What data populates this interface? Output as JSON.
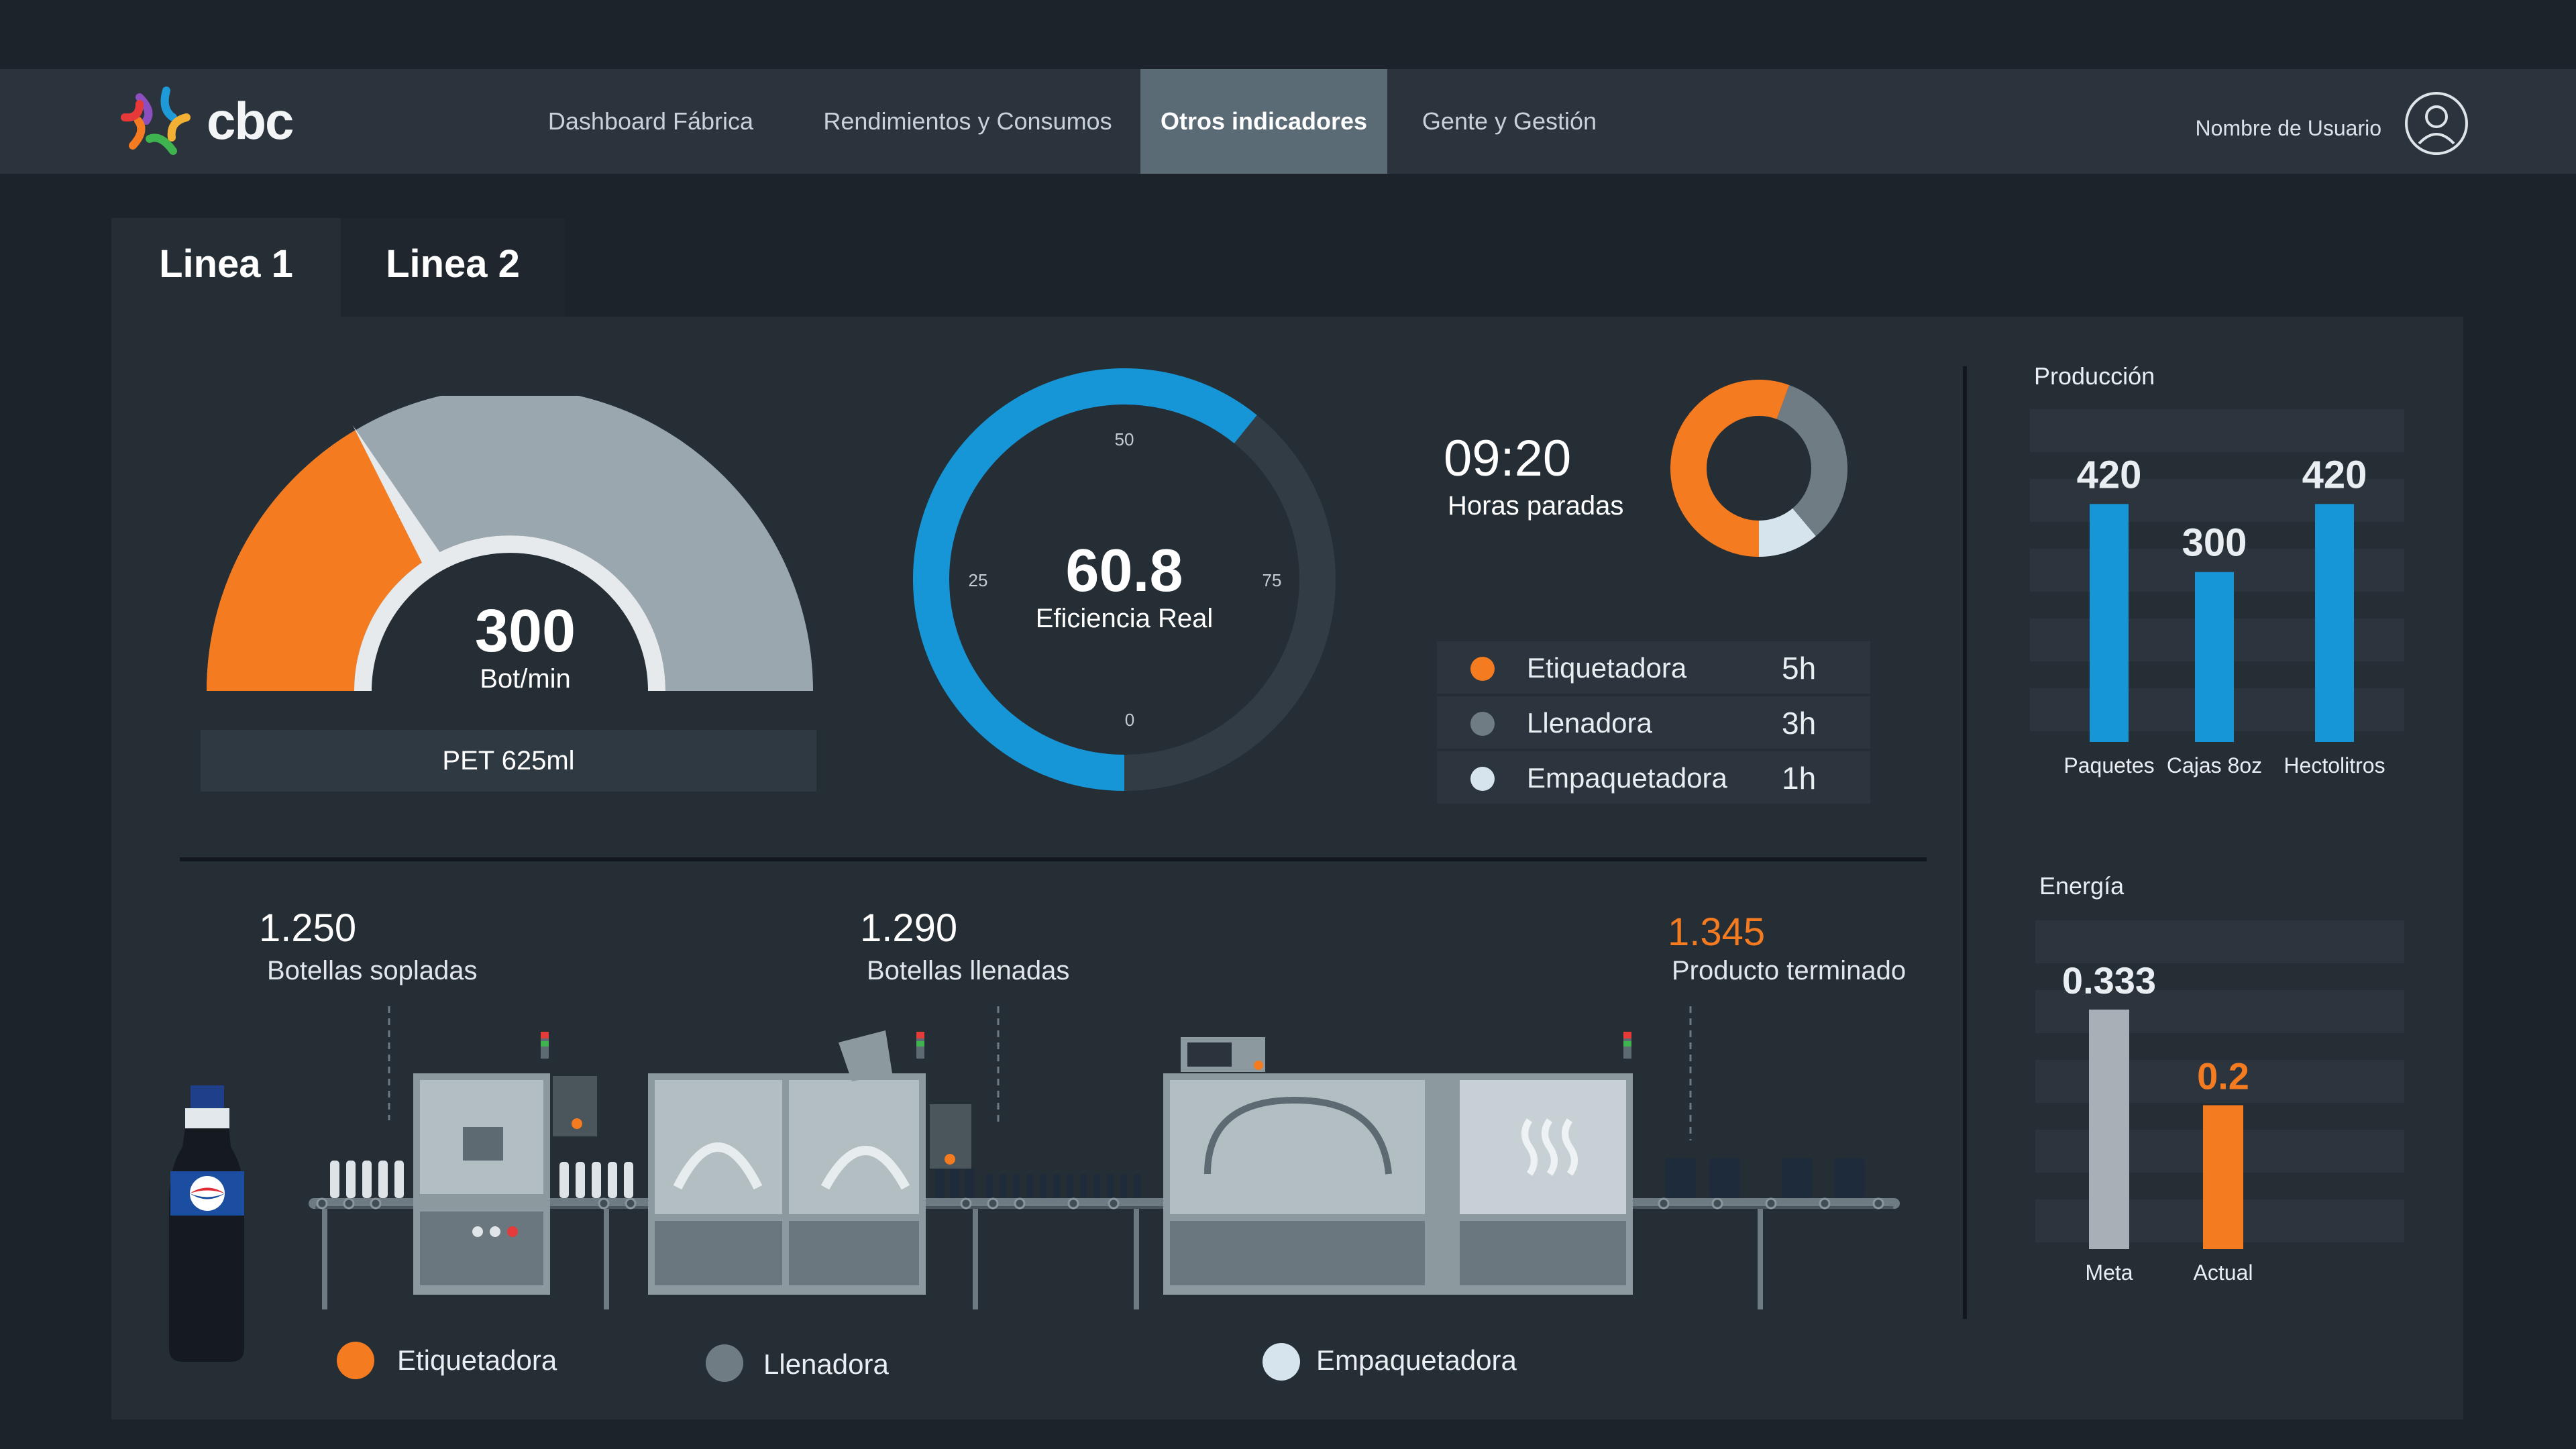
{
  "header": {
    "logo_text": "cbc",
    "nav": [
      {
        "label": "Dashboard  Fábrica",
        "active": false
      },
      {
        "label": "Rendimientos y Consumos",
        "active": false
      },
      {
        "label": "Otros indicadores",
        "active": true
      },
      {
        "label": "Gente y Gestión",
        "active": false
      }
    ],
    "user_name": "Nombre de Usuario"
  },
  "tabs": [
    {
      "label": "Linea 1",
      "active": true
    },
    {
      "label": "Linea 2",
      "active": false
    }
  ],
  "speed_gauge": {
    "value": "300",
    "unit": "Bot/min",
    "product": "PET 625ml",
    "fill_fraction": 0.33,
    "colors": {
      "fill": "#f47b20",
      "track": "#9aa7ae"
    }
  },
  "efficiency": {
    "value": "60.8",
    "label": "Eficiencia Real",
    "percent": 60.8,
    "ticks": [
      "50",
      "25",
      "75",
      "0"
    ],
    "colors": {
      "fill": "#1696d6",
      "track": "#323c45"
    }
  },
  "stops": {
    "time": "09:20",
    "label": "Horas paradas",
    "items": [
      {
        "name": "Etiquetadora",
        "value": "5h",
        "hours": 5,
        "color": "#f47b20"
      },
      {
        "name": "Llenadora",
        "value": "3h",
        "hours": 3,
        "color": "#6f7c84"
      },
      {
        "name": "Empaquetadora",
        "value": "1h",
        "hours": 1,
        "color": "#d6e4ee"
      }
    ]
  },
  "line_flow": {
    "steps": [
      {
        "value": "1.250",
        "label": "Botellas sopladas",
        "highlight": false
      },
      {
        "value": "1.290",
        "label": "Botellas llenadas",
        "highlight": false
      },
      {
        "value": "1.345",
        "label": "Producto terminado",
        "highlight": true
      }
    ],
    "legend": [
      {
        "name": "Etiquetadora",
        "color": "#f47b20"
      },
      {
        "name": "Llenadora",
        "color": "#6f7c84"
      },
      {
        "name": "Empaquetadora",
        "color": "#d6e4ee"
      }
    ]
  },
  "production": {
    "title": "Producción",
    "chart_data": {
      "type": "bar",
      "categories": [
        "Paquetes",
        "Cajas 8oz",
        "Hectolitros"
      ],
      "values": [
        420,
        300,
        420
      ],
      "value_labels": [
        "420",
        "300",
        "420"
      ],
      "ylim": [
        0,
        450
      ],
      "color": "#1696d6"
    }
  },
  "energy": {
    "title": "Energía",
    "chart_data": {
      "type": "bar",
      "categories": [
        "Meta",
        "Actual"
      ],
      "values": [
        0.333,
        0.2
      ],
      "value_labels": [
        "0.333",
        "0.2"
      ],
      "ylim": [
        0,
        0.36
      ],
      "colors": [
        "#a7b0b6",
        "#f47b20"
      ]
    }
  }
}
